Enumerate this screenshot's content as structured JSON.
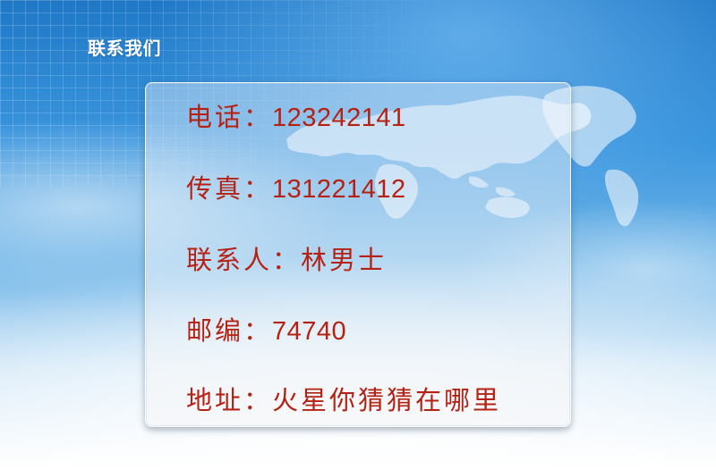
{
  "header": {
    "title": "联系我们"
  },
  "contact": {
    "phone": {
      "label": "电话：",
      "value": "123242141"
    },
    "fax": {
      "label": "传真：",
      "value": "131221412"
    },
    "contact_person": {
      "label": "联系人：",
      "value": "林男士"
    },
    "postcode": {
      "label": "邮编：",
      "value": "74740"
    },
    "address": {
      "label": "地址：",
      "value": "火星你猜猜在哪里"
    }
  },
  "colors": {
    "text_accent": "#b52214",
    "title_text": "#ffffff",
    "sky_top": "#1f78c6"
  }
}
